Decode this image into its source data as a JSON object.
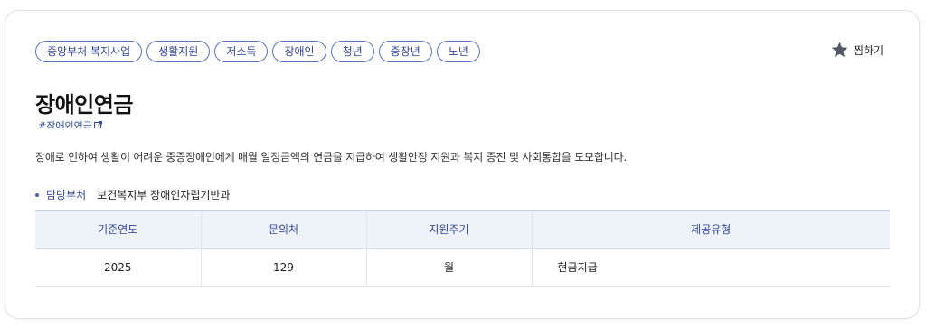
{
  "tags": [
    "중앙부처 복지사업",
    "생활지원",
    "저소득",
    "장애인",
    "청년",
    "중장년",
    "노년"
  ],
  "favorite": {
    "label": "찜하기",
    "icon": "star-icon"
  },
  "service": {
    "title": "장애인연금",
    "hashtag": "#장애인연금",
    "hashtag_icon": "external-link-icon",
    "description": "장애로 인하여 생활이 어려운 중증장애인에게 매월 일정금액의 연금을 지급하여 생활안정 지원과 복지 증진 및 사회통합을 도모합니다."
  },
  "department": {
    "label": "담당부처",
    "value": "보건복지부 장애인자립기반과"
  },
  "table": {
    "headers": [
      "기준연도",
      "문의처",
      "지원주기",
      "제공유형"
    ],
    "rows": [
      [
        "2025",
        "129",
        "월",
        "현금지급"
      ]
    ]
  },
  "colors": {
    "accent": "#34489a",
    "header_bg": "#eef2f9",
    "star": "#555a66"
  }
}
